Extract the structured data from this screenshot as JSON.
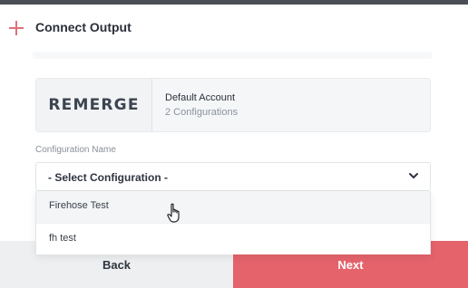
{
  "header": {
    "icon": "plus-icon",
    "title": "Connect Output"
  },
  "account": {
    "logo_text": "REMERGE",
    "name": "Default Account",
    "configurations": "2 Configurations"
  },
  "configuration": {
    "label": "Configuration Name",
    "selected": "- Select Configuration -",
    "chevron_icon": "chevron-down-icon",
    "options": [
      {
        "label": "Firehose Test"
      },
      {
        "label": "fh test"
      }
    ]
  },
  "footer": {
    "back_label": "Back",
    "next_label": "Next"
  },
  "colors": {
    "accent": "#e5636b",
    "plus_icon": "#e0707a"
  }
}
